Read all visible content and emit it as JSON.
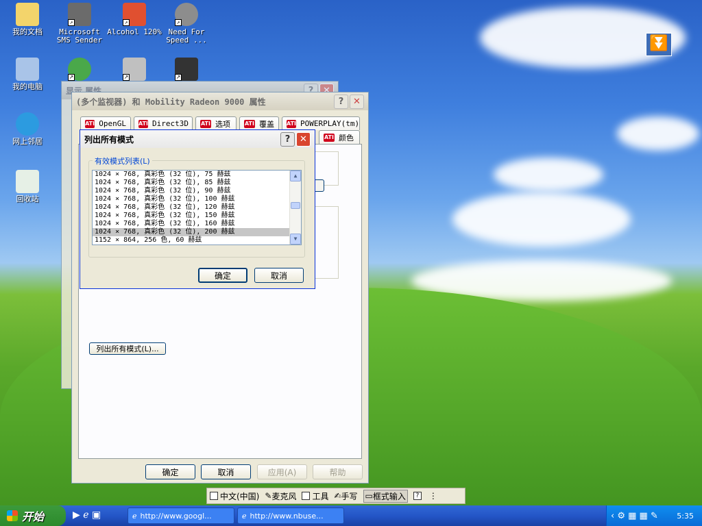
{
  "desktop": {
    "icons": [
      {
        "label": "我的文档"
      },
      {
        "label": "Microsoft SMS Sender"
      },
      {
        "label": "Alcohol 120%"
      },
      {
        "label": "Need For Speed ..."
      },
      {
        "label": "我的电脑"
      },
      {
        "label": "网上邻居"
      },
      {
        "label": "回收站"
      }
    ]
  },
  "back_window": {
    "title": "显示 属性"
  },
  "props_window": {
    "title": "(多个监视器) 和 Mobility Radeon 9000 属性",
    "tabs": [
      {
        "label": "OpenGL"
      },
      {
        "label": "Direct3D"
      },
      {
        "label": "选项"
      },
      {
        "label": "覆盖"
      },
      {
        "label": "POWERPLAY(tm)"
      },
      {
        "label": "颜色"
      }
    ],
    "list_all_modes_button": "列出所有模式(L)...",
    "ok": "确定",
    "cancel": "取消",
    "apply": "应用(A)",
    "help": "帮助"
  },
  "modes_dialog": {
    "title": "列出所有模式",
    "group_label": "有效模式列表(L)",
    "modes": [
      "1024 × 768, 真彩色 (32 位), 75 赫兹",
      "1024 × 768, 真彩色 (32 位), 85 赫兹",
      "1024 × 768, 真彩色 (32 位), 90 赫兹",
      "1024 × 768, 真彩色 (32 位), 100 赫兹",
      "1024 × 768, 真彩色 (32 位), 120 赫兹",
      "1024 × 768, 真彩色 (32 位), 150 赫兹",
      "1024 × 768, 真彩色 (32 位), 160 赫兹",
      "1024 × 768, 真彩色 (32 位), 200 赫兹",
      "1152 × 864, 256 色, 60 赫兹"
    ],
    "selected_index": 7,
    "ok": "确定",
    "cancel": "取消"
  },
  "language_bar": {
    "items": [
      {
        "label": "中文(中国)"
      },
      {
        "label": "麦克风"
      },
      {
        "label": "工具"
      },
      {
        "label": "手写"
      },
      {
        "label": "框式输入"
      }
    ]
  },
  "taskbar": {
    "start_label": "开始",
    "tasks": [
      {
        "label": "http://www.googl..."
      },
      {
        "label": "http://www.nbuse..."
      }
    ],
    "clock": "5:35"
  }
}
